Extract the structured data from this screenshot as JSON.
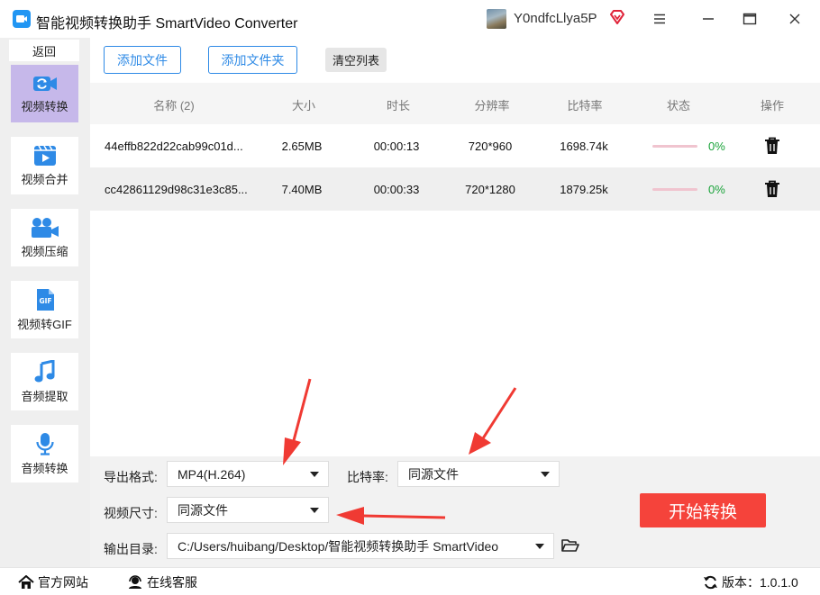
{
  "app": {
    "title": "智能视频转换助手 SmartVideo Converter",
    "username": "Y0ndfcLlya5P"
  },
  "sidebar": {
    "back_label": "返回",
    "items": [
      {
        "label": "视频转换",
        "icon": "video-convert-icon",
        "active": true
      },
      {
        "label": "视频合并",
        "icon": "video-merge-icon",
        "active": false
      },
      {
        "label": "视频压缩",
        "icon": "video-compress-icon",
        "active": false
      },
      {
        "label": "视频转GIF",
        "icon": "gif-icon",
        "active": false
      },
      {
        "label": "音频提取",
        "icon": "music-note-icon",
        "active": false
      },
      {
        "label": "音频转换",
        "icon": "microphone-icon",
        "active": false
      }
    ]
  },
  "toolbar": {
    "add_file": "添加文件",
    "add_folder": "添加文件夹",
    "clear_list": "清空列表"
  },
  "table": {
    "headers": {
      "name": "名称 (2)",
      "size": "大小",
      "duration": "时长",
      "resolution": "分辨率",
      "bitrate": "比特率",
      "status": "状态",
      "action": "操作"
    },
    "rows": [
      {
        "name": "44effb822d22cab99c01d...",
        "size": "2.65MB",
        "duration": "00:00:13",
        "resolution": "720*960",
        "bitrate": "1698.74k",
        "progress": 0,
        "progress_text": "0%"
      },
      {
        "name": "cc42861129d98c31e3c85...",
        "size": "7.40MB",
        "duration": "00:00:33",
        "resolution": "720*1280",
        "bitrate": "1879.25k",
        "progress": 0,
        "progress_text": "0%"
      }
    ]
  },
  "settings": {
    "format_label": "导出格式:",
    "format_value": "MP4(H.264)",
    "bitrate_label": "比特率:",
    "bitrate_value": "同源文件",
    "size_label": "视频尺寸:",
    "size_value": "同源文件",
    "output_label": "输出目录:",
    "output_value": "C:/Users/huibang/Desktop/智能视频转换助手 SmartVideo",
    "start_button": "开始转换"
  },
  "footer": {
    "website": "官方网站",
    "support": "在线客服",
    "version": "版本：1.0.1.0"
  },
  "colors": {
    "accent": "#2e8ae6",
    "start_button": "#f5433b",
    "active_nav": "#c6b8ea",
    "progress_text": "#1aa33a",
    "annotation_arrow": "#f03a33"
  }
}
